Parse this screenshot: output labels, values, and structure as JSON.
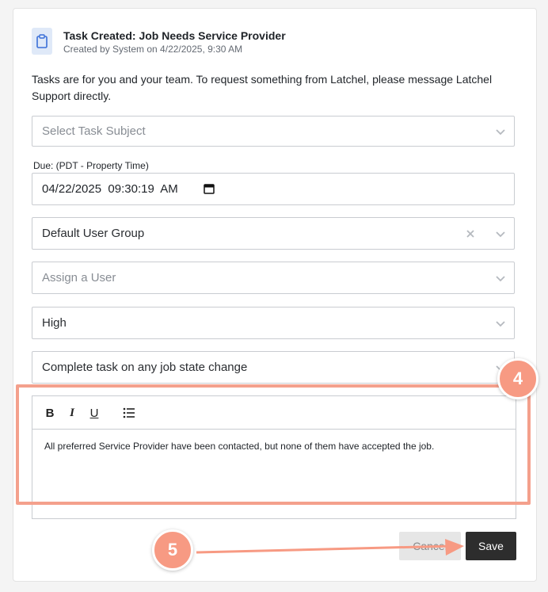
{
  "header": {
    "icon": "clipboard-icon",
    "title": "Task Created: Job Needs Service Provider",
    "subtitle": "Created by System on 4/22/2025, 9:30 AM"
  },
  "description": "Tasks are for you and your team. To request something from Latchel, please message Latchel Support directly.",
  "form": {
    "subject": {
      "placeholder": "Select Task Subject"
    },
    "due": {
      "label": "Due: (PDT - Property Time)",
      "value": "04/22/2025  09:30:19  AM"
    },
    "user_group": {
      "value": "Default User Group"
    },
    "assign_user": {
      "placeholder": "Assign a User"
    },
    "priority": {
      "value": "High"
    },
    "completion": {
      "value": "Complete task on any job state change"
    },
    "editor": {
      "toolbar": {
        "bold": "B",
        "italic": "I",
        "underline": "U"
      },
      "body": "All preferred Service Provider have been contacted, but none of them have accepted the job."
    }
  },
  "buttons": {
    "cancel": "Cancel",
    "save": "Save"
  },
  "annotations": {
    "step4": "4",
    "step5": "5"
  },
  "colors": {
    "highlight": "#f4a08c",
    "badge": "#f79a83",
    "save_bg": "#2d2d2d",
    "icon_bg": "#dfe9f8"
  }
}
